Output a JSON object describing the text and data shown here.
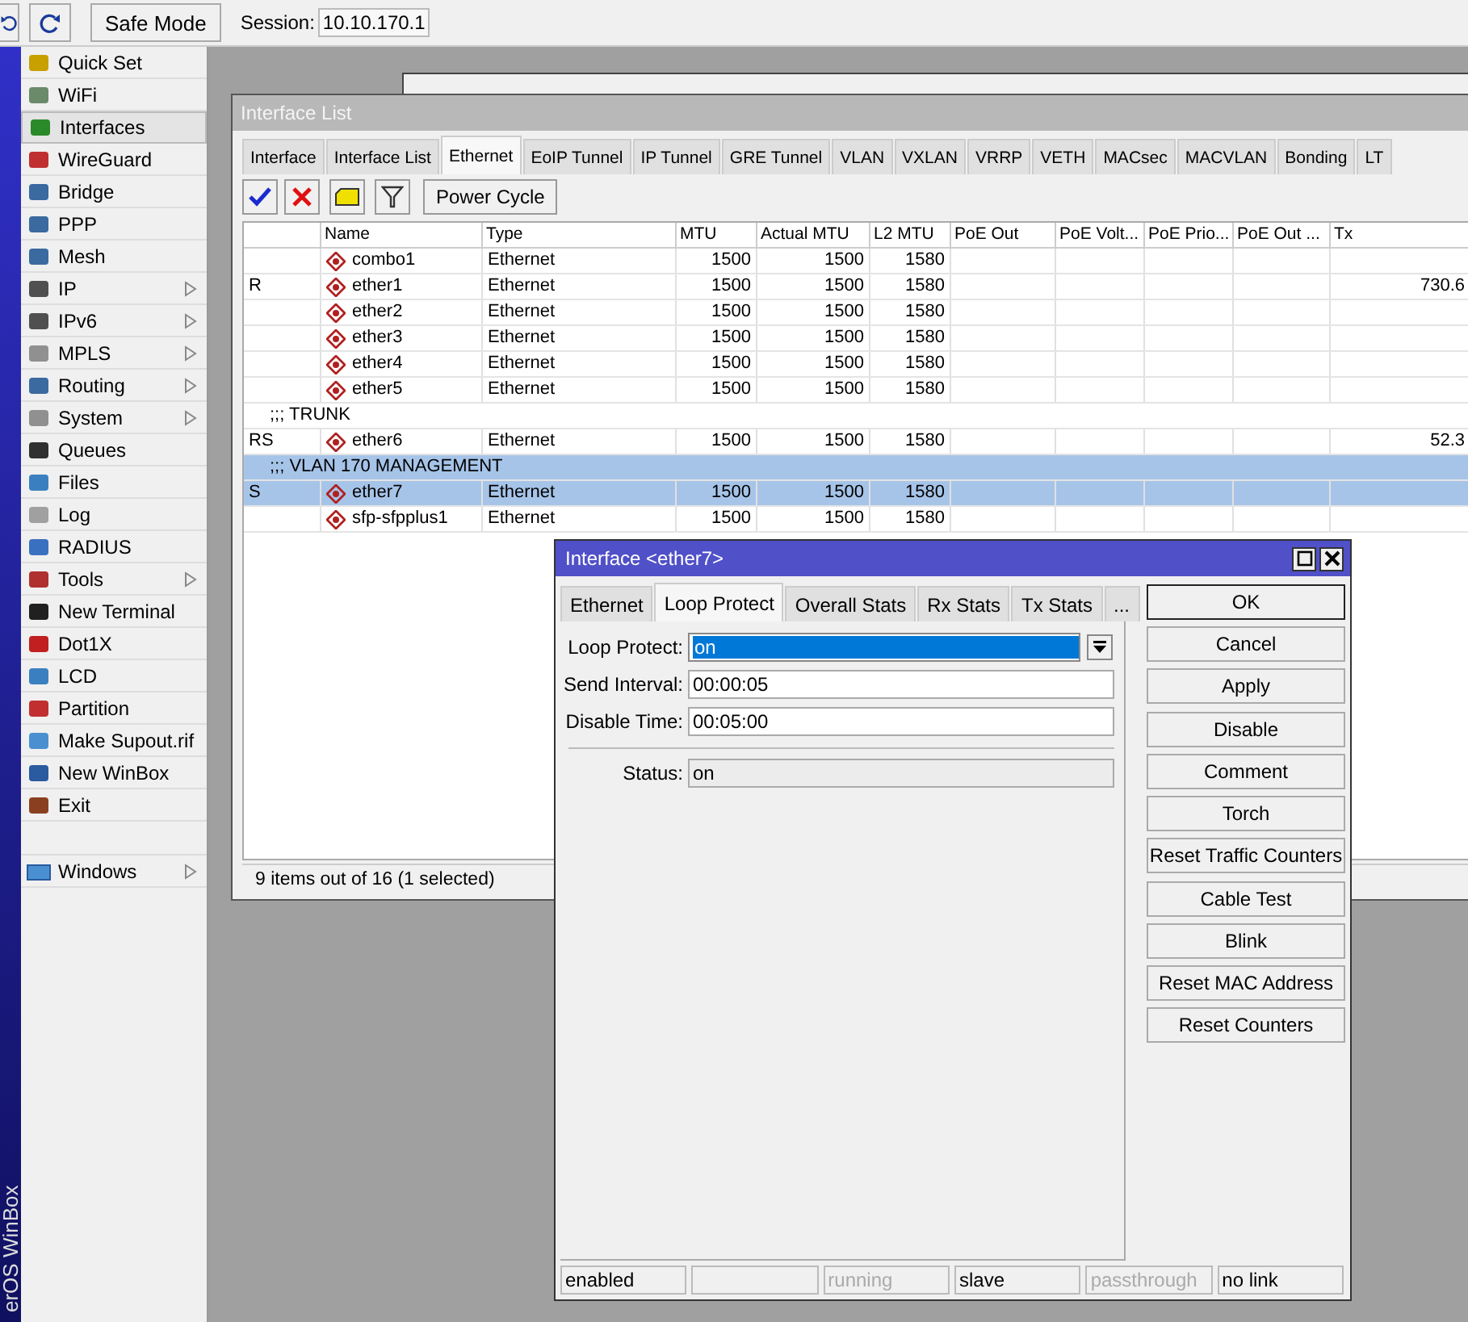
{
  "toolbar": {
    "safe_mode_label": "Safe Mode",
    "session_label": "Session:",
    "session_value": "10.10.170.1"
  },
  "side_banner": "erOS WinBox",
  "sidebar": {
    "items": [
      {
        "label": "Quick Set",
        "submenu": false,
        "selected": false
      },
      {
        "label": "WiFi",
        "submenu": false,
        "selected": false
      },
      {
        "label": "Interfaces",
        "submenu": false,
        "selected": true
      },
      {
        "label": "WireGuard",
        "submenu": false,
        "selected": false
      },
      {
        "label": "Bridge",
        "submenu": false,
        "selected": false
      },
      {
        "label": "PPP",
        "submenu": false,
        "selected": false
      },
      {
        "label": "Mesh",
        "submenu": false,
        "selected": false
      },
      {
        "label": "IP",
        "submenu": true,
        "selected": false
      },
      {
        "label": "IPv6",
        "submenu": true,
        "selected": false
      },
      {
        "label": "MPLS",
        "submenu": true,
        "selected": false
      },
      {
        "label": "Routing",
        "submenu": true,
        "selected": false
      },
      {
        "label": "System",
        "submenu": true,
        "selected": false
      },
      {
        "label": "Queues",
        "submenu": false,
        "selected": false
      },
      {
        "label": "Files",
        "submenu": false,
        "selected": false
      },
      {
        "label": "Log",
        "submenu": false,
        "selected": false
      },
      {
        "label": "RADIUS",
        "submenu": false,
        "selected": false
      },
      {
        "label": "Tools",
        "submenu": true,
        "selected": false
      },
      {
        "label": "New Terminal",
        "submenu": false,
        "selected": false
      },
      {
        "label": "Dot1X",
        "submenu": false,
        "selected": false
      },
      {
        "label": "LCD",
        "submenu": false,
        "selected": false
      },
      {
        "label": "Partition",
        "submenu": false,
        "selected": false
      },
      {
        "label": "Make Supout.rif",
        "submenu": false,
        "selected": false
      },
      {
        "label": "New WinBox",
        "submenu": false,
        "selected": false
      },
      {
        "label": "Exit",
        "submenu": false,
        "selected": false
      }
    ],
    "bottom_items": [
      {
        "label": "Windows",
        "submenu": true,
        "selected": false
      }
    ]
  },
  "interface_list": {
    "title": "Interface List",
    "tabs": [
      {
        "label": "Interface",
        "selected": false
      },
      {
        "label": "Interface List",
        "selected": false
      },
      {
        "label": "Ethernet",
        "selected": true
      },
      {
        "label": "EoIP Tunnel",
        "selected": false
      },
      {
        "label": "IP Tunnel",
        "selected": false
      },
      {
        "label": "GRE Tunnel",
        "selected": false
      },
      {
        "label": "VLAN",
        "selected": false
      },
      {
        "label": "VXLAN",
        "selected": false
      },
      {
        "label": "VRRP",
        "selected": false
      },
      {
        "label": "VETH",
        "selected": false
      },
      {
        "label": "MACsec",
        "selected": false
      },
      {
        "label": "MACVLAN",
        "selected": false
      },
      {
        "label": "Bonding",
        "selected": false
      },
      {
        "label": "LT",
        "selected": false
      }
    ],
    "power_cycle_label": "Power Cycle",
    "columns": [
      "",
      "Name",
      "Type",
      "MTU",
      "Actual MTU",
      "L2 MTU",
      "PoE Out",
      "PoE Volt...",
      "PoE Prio...",
      "PoE Out ...",
      "Tx"
    ],
    "rows": [
      {
        "kind": "interface",
        "selected": false,
        "flags": "",
        "name": "combo1",
        "type": "Ethernet",
        "mtu": "1500",
        "actual_mtu": "1500",
        "l2_mtu": "1580",
        "tx": ""
      },
      {
        "kind": "interface",
        "selected": false,
        "flags": "R",
        "name": "ether1",
        "type": "Ethernet",
        "mtu": "1500",
        "actual_mtu": "1500",
        "l2_mtu": "1580",
        "tx": "730.6"
      },
      {
        "kind": "interface",
        "selected": false,
        "flags": "",
        "name": "ether2",
        "type": "Ethernet",
        "mtu": "1500",
        "actual_mtu": "1500",
        "l2_mtu": "1580",
        "tx": ""
      },
      {
        "kind": "interface",
        "selected": false,
        "flags": "",
        "name": "ether3",
        "type": "Ethernet",
        "mtu": "1500",
        "actual_mtu": "1500",
        "l2_mtu": "1580",
        "tx": ""
      },
      {
        "kind": "interface",
        "selected": false,
        "flags": "",
        "name": "ether4",
        "type": "Ethernet",
        "mtu": "1500",
        "actual_mtu": "1500",
        "l2_mtu": "1580",
        "tx": ""
      },
      {
        "kind": "interface",
        "selected": false,
        "flags": "",
        "name": "ether5",
        "type": "Ethernet",
        "mtu": "1500",
        "actual_mtu": "1500",
        "l2_mtu": "1580",
        "tx": ""
      },
      {
        "kind": "comment",
        "selected": false,
        "text": ";;; TRUNK"
      },
      {
        "kind": "interface",
        "selected": false,
        "flags": "RS",
        "name": "ether6",
        "type": "Ethernet",
        "mtu": "1500",
        "actual_mtu": "1500",
        "l2_mtu": "1580",
        "tx": "52.3"
      },
      {
        "kind": "comment",
        "selected": true,
        "text": ";;; VLAN 170 MANAGEMENT"
      },
      {
        "kind": "interface",
        "selected": true,
        "flags": "S",
        "name": "ether7",
        "type": "Ethernet",
        "mtu": "1500",
        "actual_mtu": "1500",
        "l2_mtu": "1580",
        "tx": ""
      },
      {
        "kind": "interface",
        "selected": false,
        "flags": "",
        "name": "sfp-sfpplus1",
        "type": "Ethernet",
        "mtu": "1500",
        "actual_mtu": "1500",
        "l2_mtu": "1580",
        "tx": ""
      }
    ],
    "status": "9 items out of 16 (1 selected)"
  },
  "dialog": {
    "title": "Interface <ether7>",
    "tabs": [
      {
        "label": "Ethernet",
        "selected": false
      },
      {
        "label": "Loop Protect",
        "selected": true
      },
      {
        "label": "Overall Stats",
        "selected": false
      },
      {
        "label": "Rx Stats",
        "selected": false
      },
      {
        "label": "Tx Stats",
        "selected": false
      },
      {
        "label": "...",
        "selected": false
      }
    ],
    "fields": [
      {
        "kind": "dropdown",
        "label": "Loop Protect:",
        "value": "on"
      },
      {
        "kind": "text",
        "label": "Send Interval:",
        "value": "00:00:05"
      },
      {
        "kind": "text",
        "label": "Disable Time:",
        "value": "00:05:00"
      },
      {
        "kind": "readonly",
        "label": "Status:",
        "value": "on"
      }
    ],
    "button_groups": [
      [
        {
          "label": "OK",
          "default": true
        },
        {
          "label": "Cancel",
          "default": false
        },
        {
          "label": "Apply",
          "default": false
        }
      ],
      [
        {
          "label": "Disable",
          "default": false
        },
        {
          "label": "Comment",
          "default": false
        },
        {
          "label": "Torch",
          "default": false
        },
        {
          "label": "Reset Traffic Counters",
          "default": false
        }
      ],
      [
        {
          "label": "Cable Test",
          "default": false
        },
        {
          "label": "Blink",
          "default": false
        },
        {
          "label": "Reset MAC Address",
          "default": false
        },
        {
          "label": "Reset Counters",
          "default": false
        }
      ]
    ],
    "status_cells": [
      {
        "text": "enabled",
        "dimmed": false
      },
      {
        "text": null
      },
      {
        "text": "running",
        "dimmed": true
      },
      {
        "text": "slave",
        "dimmed": false
      },
      {
        "text": "passthrough",
        "dimmed": true
      },
      {
        "text": "no link",
        "dimmed": false
      }
    ]
  }
}
